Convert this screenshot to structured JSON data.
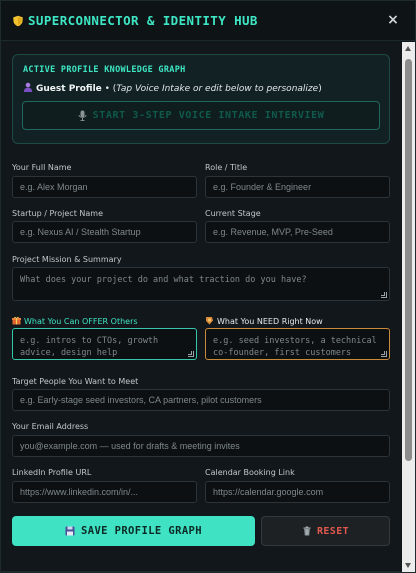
{
  "window": {
    "title": "SUPERCONNECTOR & IDENTITY HUB",
    "close_label": "×",
    "title_icon": "shield-icon"
  },
  "knowledge_graph": {
    "heading": "ACTIVE PROFILE KNOWLEDGE GRAPH",
    "profile_name": "Guest Profile",
    "separator": " • (",
    "profile_hint": "Tap Voice Intake or edit below to personalize",
    "closing": ")",
    "voice_button_label": "START 3-STEP VOICE INTAKE INTERVIEW"
  },
  "form": {
    "full_name": {
      "label": "Your Full Name",
      "placeholder": "e.g. Alex Morgan"
    },
    "role": {
      "label": "Role / Title",
      "placeholder": "e.g. Founder & Engineer"
    },
    "startup": {
      "label": "Startup / Project Name",
      "placeholder": "e.g. Nexus AI / Stealth Startup"
    },
    "stage": {
      "label": "Current Stage",
      "placeholder": "e.g. Revenue, MVP, Pre-Seed"
    },
    "mission": {
      "label": "Project Mission & Summary",
      "placeholder": "What does your project do and what traction do you have?"
    },
    "offer": {
      "label": "What You Can OFFER Others",
      "placeholder": "e.g. intros to CTOs, growth advice, design help",
      "icon": "gift-icon"
    },
    "need": {
      "label": "What You NEED Right Now",
      "placeholder": "e.g. seed investors, a technical co-founder, first customers",
      "icon": "target-icon"
    },
    "target_people": {
      "label": "Target People You Want to Meet",
      "placeholder": "e.g. Early-stage seed investors, CA partners, pilot customers"
    },
    "email": {
      "label": "Your Email Address",
      "placeholder": "you@example.com — used for drafts & meeting invites"
    },
    "linkedin": {
      "label": "LinkedIn Profile URL",
      "placeholder": "https://www.linkedin.com/in/..."
    },
    "calendar": {
      "label": "Calendar Booking Link",
      "placeholder": "https://calendar.google.com"
    }
  },
  "actions": {
    "save_label": "SAVE PROFILE GRAPH",
    "reset_label": "RESET"
  },
  "colors": {
    "accent": "#3ee6c4",
    "danger": "#e0584e",
    "background": "#12171b"
  }
}
